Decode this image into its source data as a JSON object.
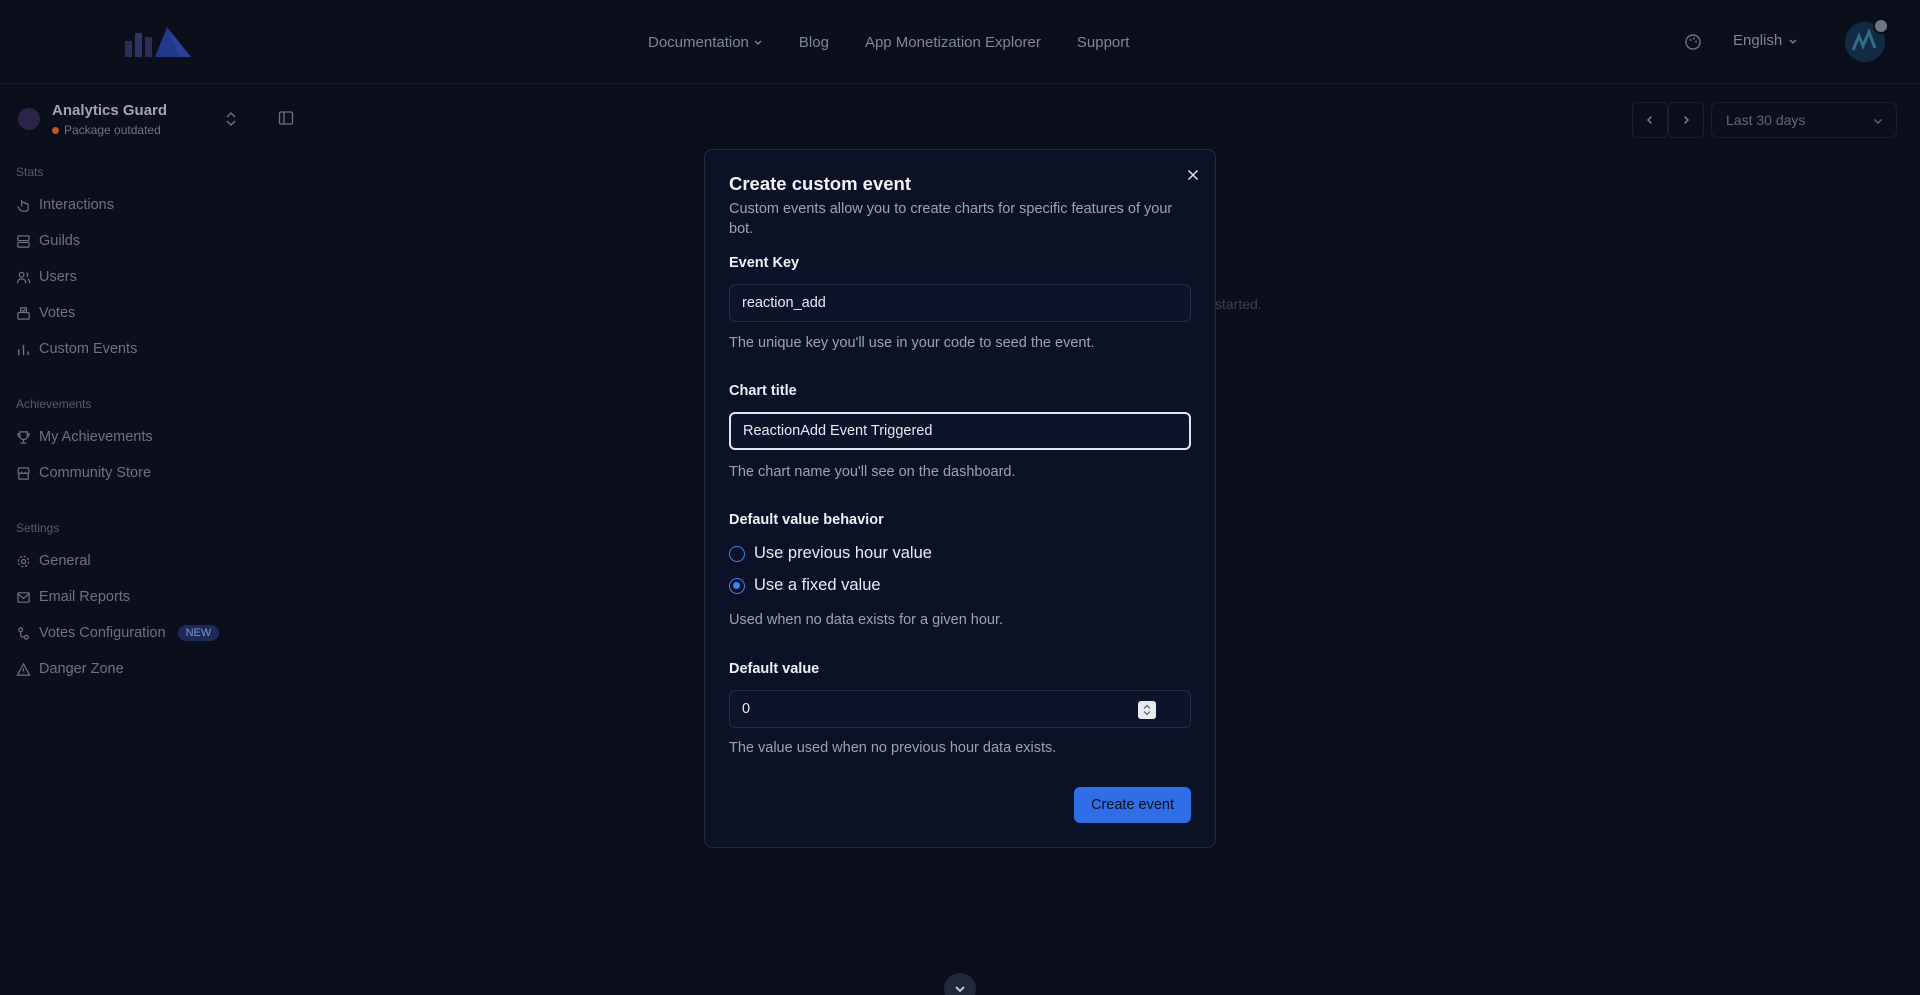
{
  "nav": {
    "links": [
      "Documentation",
      "Blog",
      "App Monetization Explorer",
      "Support"
    ],
    "language": "English"
  },
  "project": {
    "name": "Analytics Guard",
    "status": "Package outdated"
  },
  "sidebar": {
    "sections": {
      "stats": "Stats",
      "achievements": "Achievements",
      "settings": "Settings"
    },
    "items": {
      "interactions": "Interactions",
      "guilds": "Guilds",
      "users": "Users",
      "votes": "Votes",
      "custom_events": "Custom Events",
      "my_achievements": "My Achievements",
      "community_store": "Community Store",
      "general": "General",
      "email_reports": "Email Reports",
      "votes_configuration": "Votes Configuration",
      "danger_zone": "Danger Zone"
    },
    "new_badge": "NEW"
  },
  "toolbar": {
    "date_range": "Last 30 days"
  },
  "background_text": "started.",
  "modal": {
    "title": "Create custom event",
    "description": "Custom events allow you to create charts for specific features of your bot.",
    "event_key": {
      "label": "Event Key",
      "value": "reaction_add",
      "helper": "The unique key you'll use in your code to seed the event."
    },
    "chart_title": {
      "label": "Chart title",
      "value": "ReactionAdd Event Triggered",
      "helper": "The chart name you'll see on the dashboard."
    },
    "default_behavior": {
      "label": "Default value behavior",
      "options": [
        "Use previous hour value",
        "Use a fixed value"
      ],
      "selected": "Use a fixed value",
      "helper": "Used when no data exists for a given hour."
    },
    "default_value": {
      "label": "Default value",
      "value": "0",
      "helper": "The value used when no previous hour data exists."
    },
    "submit_label": "Create event"
  },
  "colors": {
    "background": "#0b0f1c",
    "modal": "#0c1226",
    "accent": "#2f6ee6",
    "status_warning": "#c2571a"
  }
}
